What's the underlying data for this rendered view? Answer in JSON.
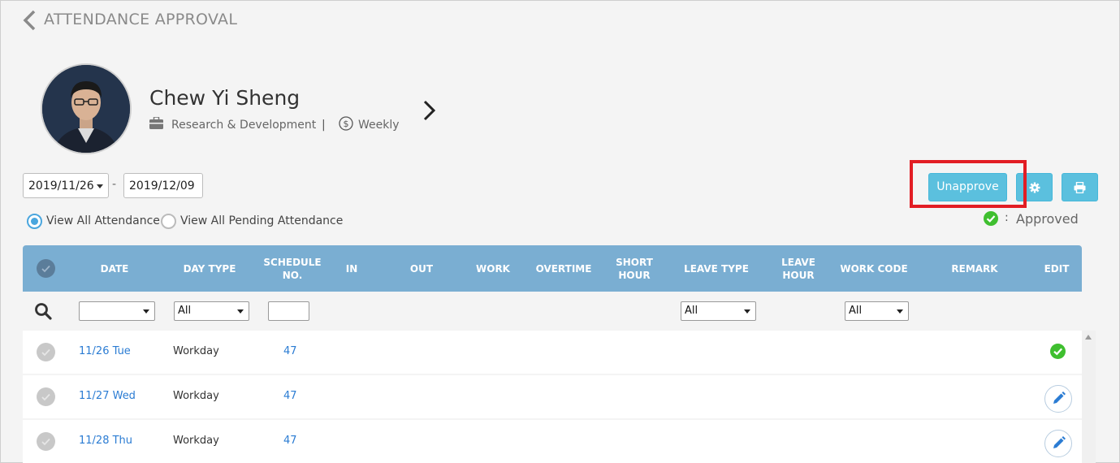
{
  "header": {
    "title": "ATTENDANCE APPROVAL"
  },
  "employee": {
    "name": "Chew Yi Sheng",
    "department": "Research & Development",
    "separator": "|",
    "pay_cycle": "Weekly"
  },
  "date_range": {
    "start": "2019/11/26",
    "dash": "-",
    "end": "2019/12/09"
  },
  "view_options": [
    {
      "label": "View All Attendance",
      "selected": true
    },
    {
      "label": "View All Pending Attendance",
      "selected": false
    }
  ],
  "toolbar": {
    "unapprove_label": "Unapprove"
  },
  "legend": {
    "colon": ":",
    "label": "Approved"
  },
  "table": {
    "columns": [
      "DATE",
      "DAY TYPE",
      "SCHEDULE\nNO.",
      "IN",
      "OUT",
      "WORK",
      "OVERTIME",
      "SHORT\nHOUR",
      "LEAVE TYPE",
      "LEAVE\nHOUR",
      "WORK CODE",
      "REMARK",
      "EDIT"
    ],
    "filters": {
      "day_type": "All",
      "leave_type": "All",
      "work_code": "All"
    },
    "rows": [
      {
        "date": "11/26 Tue",
        "day_type": "Workday",
        "schedule_no": "47",
        "status": "approved"
      },
      {
        "date": "11/27 Wed",
        "day_type": "Workday",
        "schedule_no": "47",
        "status": "editable"
      },
      {
        "date": "11/28 Thu",
        "day_type": "Workday",
        "schedule_no": "47",
        "status": "editable"
      }
    ]
  },
  "colors": {
    "header_bg": "#7aaed2",
    "button": "#5bc0de",
    "approved": "#3fbf2f",
    "link": "#2b7cd3",
    "highlight": "#e21d24"
  }
}
